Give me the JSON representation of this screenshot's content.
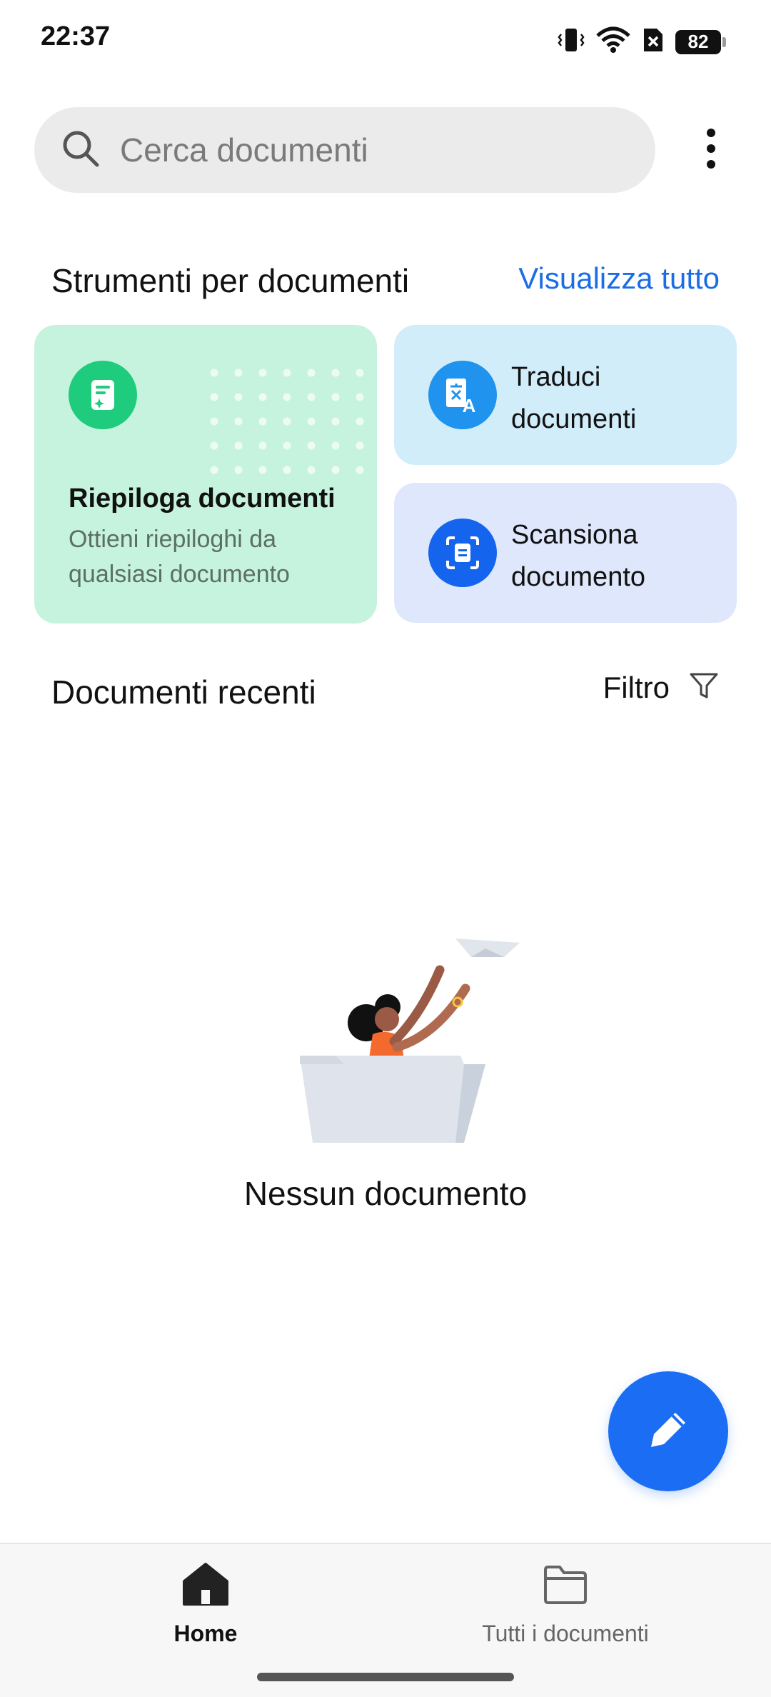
{
  "status_bar": {
    "time": "22:37",
    "battery": "82",
    "icons": [
      "vibrate-icon",
      "wifi-icon",
      "no-sim-icon",
      "battery-icon"
    ]
  },
  "search": {
    "placeholder": "Cerca documenti",
    "icon": "search-icon"
  },
  "tools": {
    "title": "Strumenti per documenti",
    "view_all": "Visualizza tutto",
    "summarize": {
      "title": "Riepiloga documenti",
      "description": "Ottieni riepiloghi da qualsiasi documento",
      "icon": "summary-doc-icon"
    },
    "translate": {
      "label": "Traduci documenti",
      "icon": "translate-icon"
    },
    "scan": {
      "label": "Scansiona documento",
      "icon": "scan-icon"
    }
  },
  "recent": {
    "title": "Documenti recenti",
    "filter_label": "Filtro",
    "empty_text": "Nessun documento"
  },
  "nav": {
    "home_label": "Home",
    "all_docs_label": "Tutti i documenti"
  },
  "colors": {
    "accent": "#1a6de6",
    "fab": "#1b6ef3",
    "summarize_card": "#c6f3dd",
    "translate_card": "#d2edfa",
    "scan_card": "#dee7fb"
  }
}
